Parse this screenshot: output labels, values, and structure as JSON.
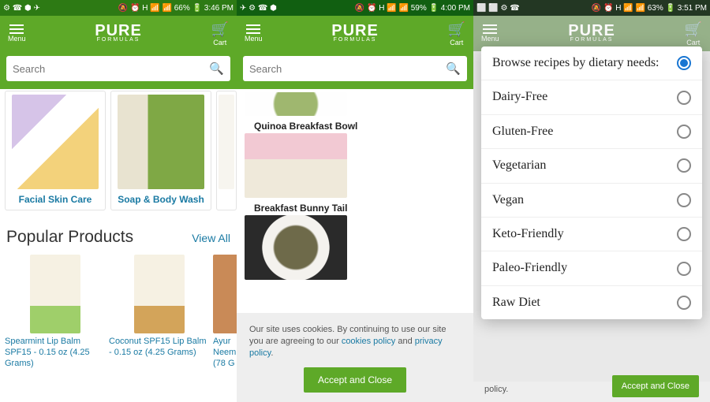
{
  "status": {
    "s1": {
      "left": "⚙ ☎ ⬢ ✈",
      "right": "🔕 ⏰ H 📶 📶 66% 🔋 3:46 PM"
    },
    "s2": {
      "left": "✈ ⚙ ☎ ⬢",
      "right": "🔕 ⏰ H 📶 📶 59% 🔋 4:00 PM"
    },
    "s3": {
      "left": "⬜ ⬜ ⚙ ☎",
      "right": "🔕 ⏰ H 📶 📶 63% 🔋 3:51 PM"
    }
  },
  "header": {
    "menu": "Menu",
    "cart": "Cart",
    "logo_main": "PURE",
    "logo_sub": "FORMULAS"
  },
  "search": {
    "placeholder": "Search"
  },
  "screen1": {
    "categories": [
      {
        "label": "Facial Skin Care"
      },
      {
        "label": "Soap & Body Wash"
      }
    ],
    "popular_heading": "Popular Products",
    "view_all": "View All",
    "products": [
      {
        "label": "Spearmint Lip Balm SPF15 - 0.15 oz (4.25 Grams)"
      },
      {
        "label": "Coconut SPF15 Lip Balm - 0.15 oz (4.25 Grams)"
      },
      {
        "label": "Ayur Neem (78 G"
      }
    ]
  },
  "screen2": {
    "recipes": [
      {
        "title": ""
      },
      {
        "title": "Quinoa Breakfast Bowl"
      },
      {
        "title": "Breakfast Bunny Tail"
      }
    ],
    "cookie_text_a": "Our site uses cookies. By continuing to use our site you are agreeing to our ",
    "cookie_link1": "cookies policy",
    "cookie_mid": " and ",
    "cookie_link2": "privacy policy",
    "cookie_end": ".",
    "cookie_btn": "Accept and Close"
  },
  "screen3": {
    "dialog_header": "Browse recipes by dietary needs:",
    "options": [
      "Dairy-Free",
      "Gluten-Free",
      "Vegetarian",
      "Vegan",
      "Keto-Friendly",
      "Paleo-Friendly",
      "Raw Diet"
    ],
    "selected": 0,
    "bg_text": "policy.",
    "cookie_btn": "Accept and Close"
  }
}
